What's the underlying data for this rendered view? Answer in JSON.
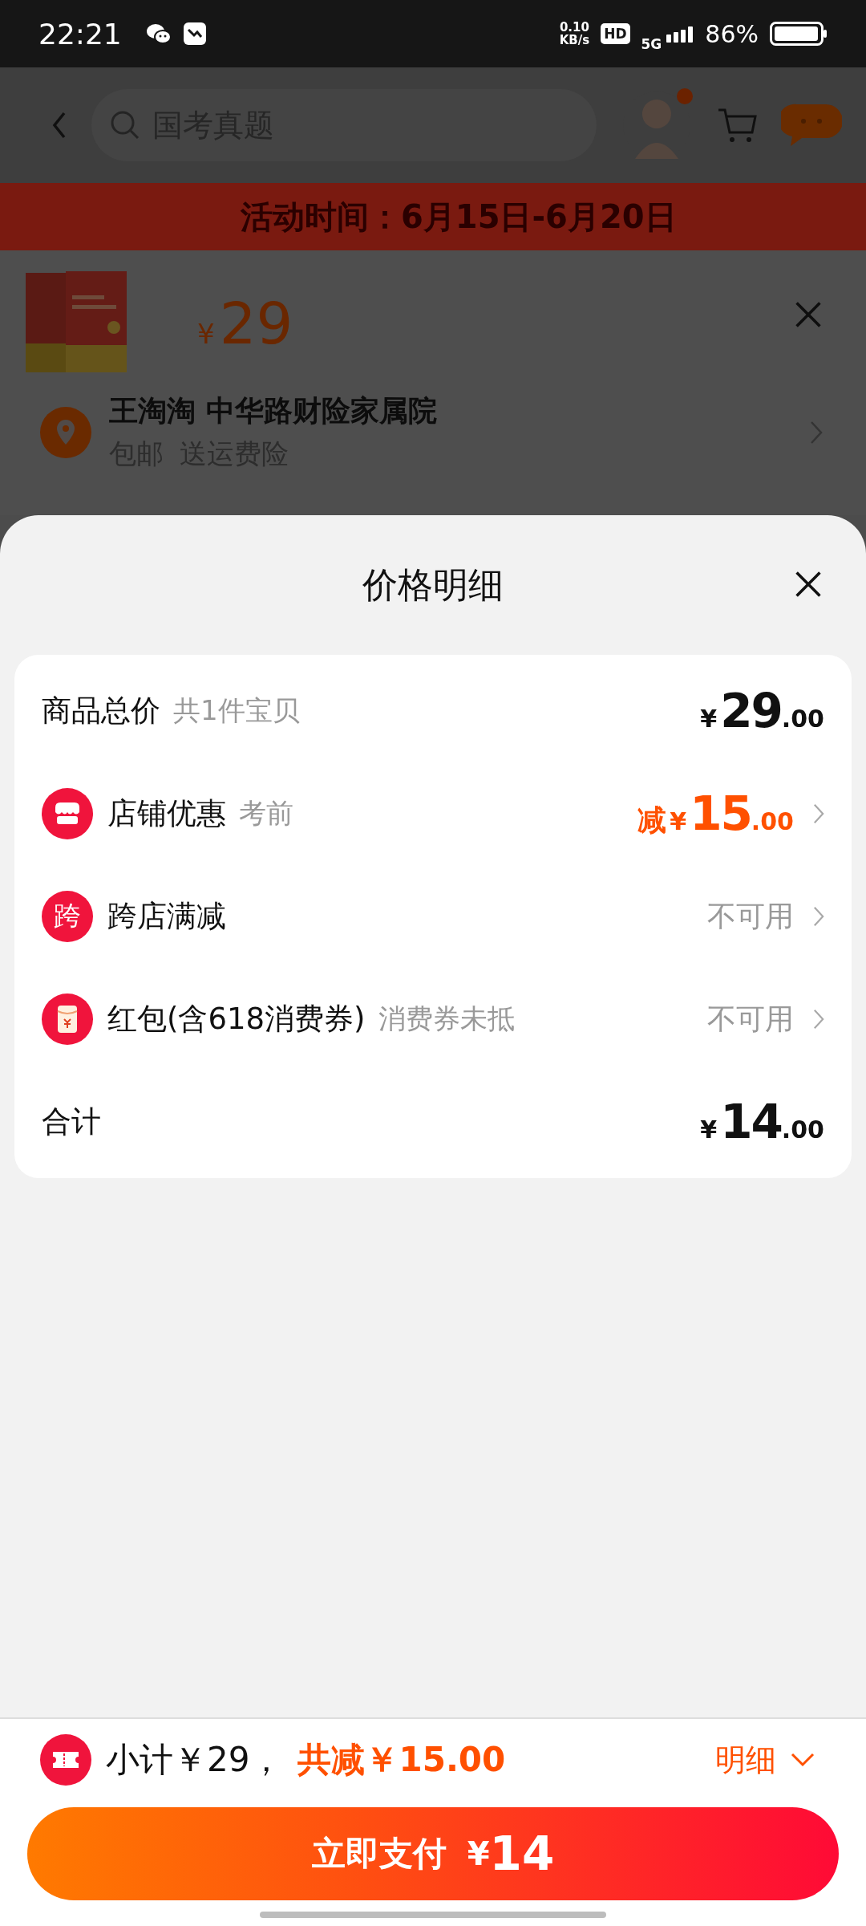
{
  "status_bar": {
    "time": "22:21",
    "speed_value": "0.10",
    "speed_unit": "KB/s",
    "hd": "HD",
    "network": "5G",
    "battery": "86%"
  },
  "header": {
    "search_placeholder": "国考真题",
    "avatar_badge": true
  },
  "banner": {
    "text": "活动时间：6月15日-6月20日"
  },
  "product": {
    "currency": "¥",
    "price": "29"
  },
  "address": {
    "title": "王淘淘 中华路财险家属院",
    "tags": [
      "包邮",
      "送运费险"
    ]
  },
  "sheet": {
    "title": "价格明细",
    "rows": [
      {
        "kind": "plain",
        "label": "商品总价",
        "note": "共1件宝贝",
        "value": {
          "kind": "price",
          "symbol": "¥",
          "integer": "29",
          "decimal": ".00",
          "highlight": false
        },
        "chevron": false
      },
      {
        "kind": "store",
        "label": "店铺优惠",
        "note": "考前",
        "value": {
          "kind": "price",
          "prefix": "减",
          "symbol": "¥",
          "integer": "15",
          "decimal": ".00",
          "highlight": true
        },
        "chevron": true
      },
      {
        "kind": "cross-store",
        "icon_text": "跨",
        "label": "跨店满减",
        "value": {
          "kind": "text",
          "text": "不可用"
        },
        "chevron": true
      },
      {
        "kind": "envelope",
        "label": "红包(含618消费券)",
        "note": "消费券未抵",
        "value": {
          "kind": "text",
          "text": "不可用"
        },
        "chevron": true
      },
      {
        "kind": "plain",
        "label": "合计",
        "value": {
          "kind": "price",
          "symbol": "¥",
          "integer": "14",
          "decimal": ".00",
          "highlight": false
        },
        "chevron": false
      }
    ]
  },
  "footer": {
    "subtotal": "小计￥29，",
    "discount": "共减￥15.00",
    "details": "明细",
    "pay_label": "立即支付",
    "pay_currency": "¥",
    "pay_amount": "14"
  }
}
